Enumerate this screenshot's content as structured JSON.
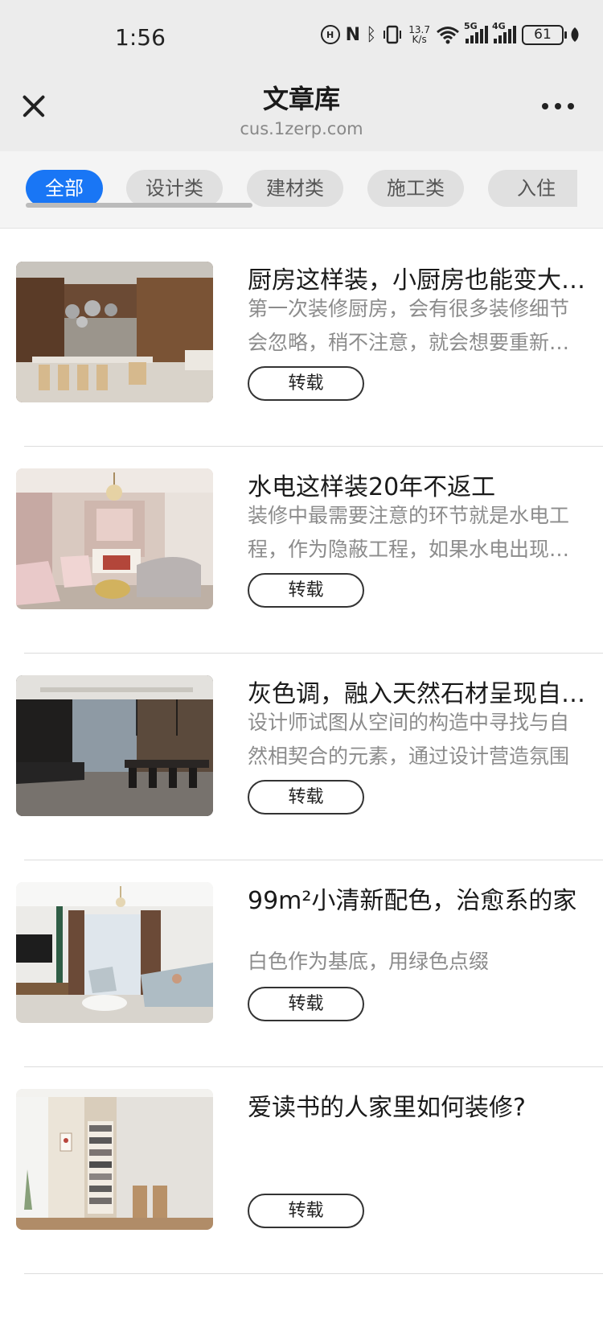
{
  "status_bar": {
    "time": "1:56",
    "network_speed_value": "13.7",
    "network_speed_unit": "K/s",
    "signal_1_tag": "5G",
    "signal_2_tag": "4G",
    "battery": "61"
  },
  "header": {
    "title": "文章库",
    "url": "cus.1zerp.com"
  },
  "tabs": [
    {
      "label": "全部",
      "active": true
    },
    {
      "label": "设计类",
      "active": false
    },
    {
      "label": "建材类",
      "active": false
    },
    {
      "label": "施工类",
      "active": false
    },
    {
      "label": "入住",
      "active": false
    }
  ],
  "articles": [
    {
      "title": "厨房这样装，小厨房也能变大厨房",
      "desc": "第一次装修厨房，会有很多装修细节会忽略，稍不注意，就会想要重新装修",
      "repost_label": "转载"
    },
    {
      "title": "水电这样装20年不返工",
      "desc": "装修中最需要注意的环节就是水电工程，作为隐蔽工程，如果水电出现问题",
      "repost_label": "转载"
    },
    {
      "title": "灰色调，融入天然石材呈现自然美",
      "desc": "设计师试图从空间的构造中寻找与自然相契合的元素，通过设计营造氛围",
      "repost_label": "转载"
    },
    {
      "title": "99m²小清新配色，治愈系的家",
      "desc": "白色作为基底，用绿色点缀",
      "repost_label": "转载"
    },
    {
      "title": "爱读书的人家里如何装修?",
      "desc": "",
      "repost_label": "转载"
    }
  ]
}
